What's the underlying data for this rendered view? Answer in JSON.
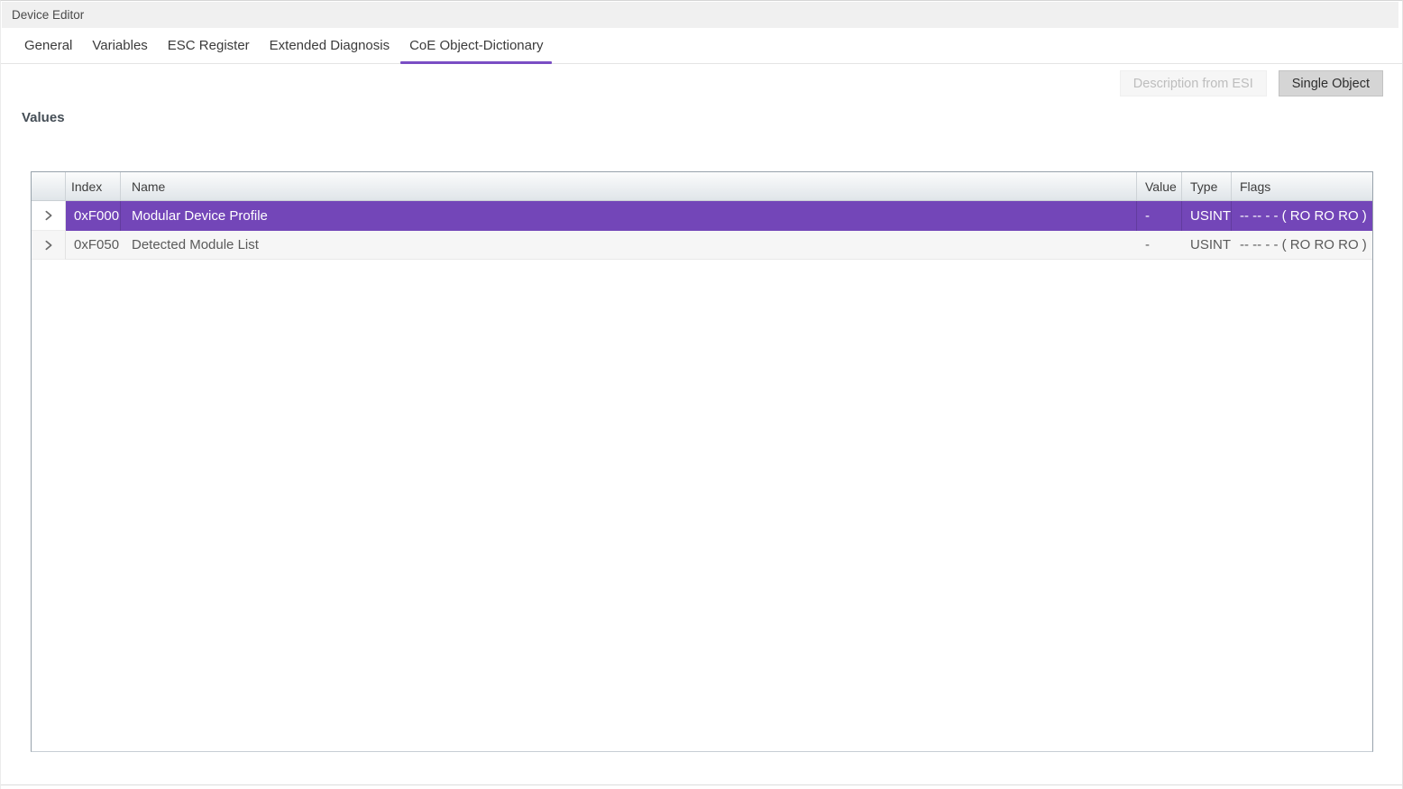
{
  "window": {
    "title": "Device Editor"
  },
  "tabs": [
    {
      "label": "General"
    },
    {
      "label": "Variables"
    },
    {
      "label": "ESC Register"
    },
    {
      "label": "Extended Diagnosis"
    },
    {
      "label": "CoE Object-Dictionary"
    }
  ],
  "toolbar": {
    "description_from_esi_label": "Description from ESI",
    "single_object_label": "Single Object"
  },
  "section": {
    "values_label": "Values"
  },
  "table": {
    "columns": [
      "Index",
      "Name",
      "Value",
      "Type",
      "Flags"
    ],
    "rows": [
      {
        "index": "0xF000",
        "name": "Modular Device Profile",
        "value": "-",
        "type": "USINT",
        "flags": "-- -- - - ( RO RO RO )"
      },
      {
        "index": "0xF050",
        "name": "Detected Module List",
        "value": "-",
        "type": "USINT",
        "flags": "-- -- - - ( RO RO RO )"
      }
    ]
  },
  "colors": {
    "selected_row_purple": "#7346b8",
    "tab_underline_purple": "#7a4ec4",
    "titlebar_gray": "#f0f0f0"
  }
}
